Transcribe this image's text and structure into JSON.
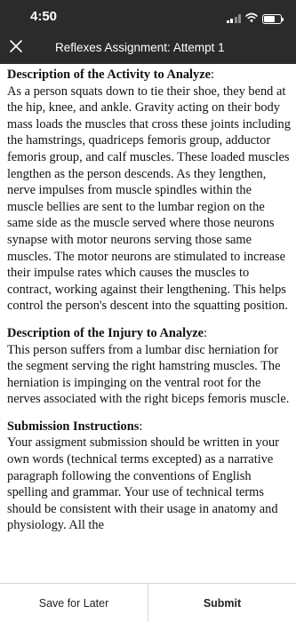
{
  "status_bar": {
    "time": "4:50",
    "icons": [
      "signal-icon",
      "wifi-icon",
      "battery-icon"
    ]
  },
  "nav_bar": {
    "close_icon": "close-icon",
    "title": "Reflexes Assignment: Attempt 1"
  },
  "sections": [
    {
      "heading": "Description of the Activity to Analyze",
      "heading_suffix": ":",
      "body": "As a person squats down to tie their shoe, they bend at the hip, knee, and ankle.  Gravity acting on their body mass loads the muscles that cross these joints including the hamstrings, quadriceps femoris group, adductor femoris group, and calf muscles.  These loaded muscles lengthen as the person descends.  As they lengthen, nerve impulses from muscle spindles within the muscle bellies are sent to the lumbar region on the same side as the muscle served where those neurons synapse with motor neurons serving those same muscles.  The motor neurons are stimulated to increase their impulse rates which causes the muscles to contract, working against their lengthening.  This helps control the person's descent into the squatting position."
    },
    {
      "heading": "Description of the Injury to Analyze",
      "heading_suffix": ":",
      "body": "This person suffers from a lumbar disc herniation for the segment serving the right hamstring muscles.  The herniation is impinging on the ventral root for the nerves associated with the right biceps femoris muscle."
    },
    {
      "heading": "Submission Instructions",
      "heading_suffix": ":",
      "body": "Your assigment submission should be written in your own words (technical terms excepted) as a narrative paragraph following the conventions of English spelling and grammar.  Your use of technical terms should be consistent with their usage in anatomy and physiology.  All the"
    }
  ],
  "footer": {
    "save_label": "Save for Later",
    "submit_label": "Submit"
  },
  "colors": {
    "header_bg": "#2b2b2b",
    "text": "#111111",
    "footer_divider": "#d6d6d6"
  }
}
